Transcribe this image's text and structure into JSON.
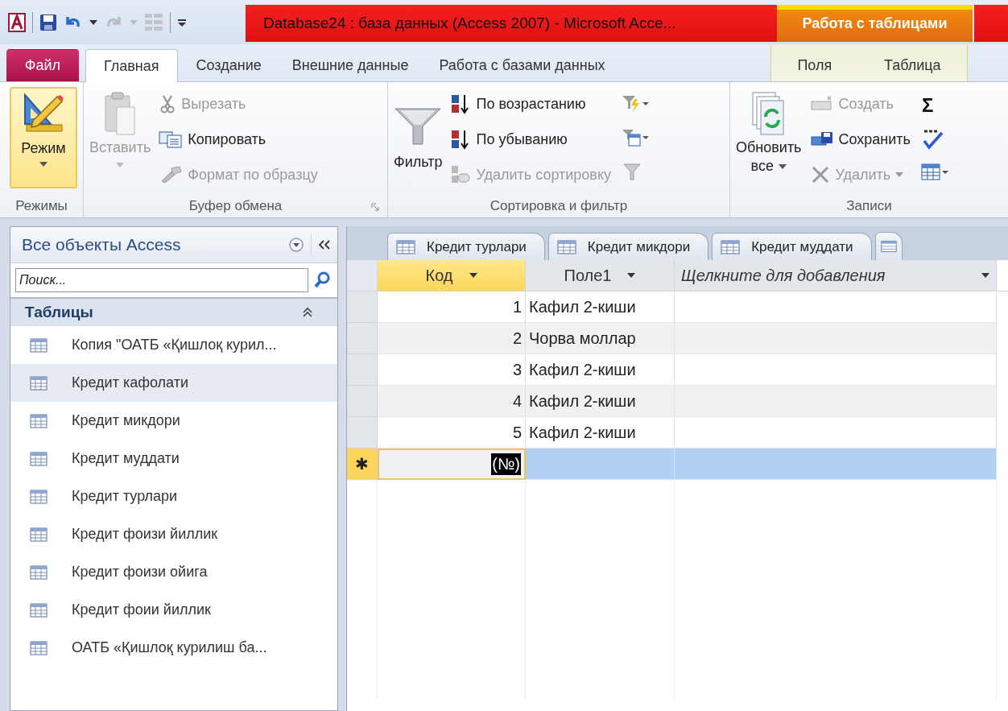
{
  "window": {
    "title": "Database24 : база данных (Access 2007)  -  Microsoft Acce...",
    "context_group": "Работа с таблицами"
  },
  "tabs": [
    {
      "label": "Файл",
      "kind": "file",
      "selected": false
    },
    {
      "label": "Главная",
      "kind": "normal",
      "selected": true
    },
    {
      "label": "Создание",
      "kind": "normal",
      "selected": false
    },
    {
      "label": "Внешние данные",
      "kind": "normal",
      "selected": false
    },
    {
      "label": "Работа с базами данных",
      "kind": "normal",
      "selected": false
    },
    {
      "label": "Поля",
      "kind": "contextual",
      "selected": false
    },
    {
      "label": "Таблица",
      "kind": "contextual",
      "selected": false
    }
  ],
  "ribbon": {
    "groups": [
      {
        "label": "Режимы",
        "items": [
          {
            "label": "Режим",
            "disabled": false
          }
        ]
      },
      {
        "label": "Буфер обмена",
        "items": [
          {
            "label": "Вставить",
            "disabled": true
          },
          {
            "label": "Вырезать",
            "disabled": true
          },
          {
            "label": "Копировать",
            "disabled": false
          },
          {
            "label": "Формат по образцу",
            "disabled": true
          }
        ]
      },
      {
        "label": "Сортировка и фильтр",
        "items": [
          {
            "label": "Фильтр",
            "disabled": false
          },
          {
            "label": "По возрастанию",
            "disabled": false
          },
          {
            "label": "По убыванию",
            "disabled": false
          },
          {
            "label": "Удалить сортировку",
            "disabled": true
          }
        ]
      },
      {
        "label": "Записи",
        "items": [
          {
            "label": "Обновить",
            "label2": "все",
            "disabled": false
          },
          {
            "label": "Создать",
            "disabled": true
          },
          {
            "label": "Сохранить",
            "disabled": false
          },
          {
            "label": "Удалить",
            "disabled": true
          },
          {
            "label": "Σ",
            "disabled": false
          }
        ]
      }
    ]
  },
  "nav": {
    "title": "Все объекты Access",
    "search": {
      "placeholder": "Поиск..."
    },
    "section": "Таблицы",
    "items": [
      {
        "label": "Копия \"ОАТБ «Қишлоқ курил...",
        "selected": false
      },
      {
        "label": "Кредит кафолати",
        "selected": true
      },
      {
        "label": "Кредит микдори",
        "selected": false
      },
      {
        "label": "Кредит муддати",
        "selected": false
      },
      {
        "label": "Кредит турлари",
        "selected": false
      },
      {
        "label": "Кредит фоизи йиллик",
        "selected": false
      },
      {
        "label": "Кредит фоизи ойига",
        "selected": false
      },
      {
        "label": "Кредит фоии йиллик",
        "selected": false
      },
      {
        "label": "ОАТБ «Қишлоқ курилиш  ба...",
        "selected": false
      }
    ]
  },
  "doc_tabs": [
    {
      "label": "Кредит турлари"
    },
    {
      "label": "Кредит микдори"
    },
    {
      "label": "Кредит муддати"
    }
  ],
  "table": {
    "columns": [
      {
        "label": "Код",
        "kind": "field",
        "selected": true
      },
      {
        "label": "Поле1",
        "kind": "field",
        "selected": false
      },
      {
        "label": "Щелкните для добавления",
        "kind": "add",
        "selected": false
      }
    ],
    "rows": [
      {
        "code": "1",
        "field1": "Кафил 2-киши"
      },
      {
        "code": "2",
        "field1": "Чорва моллар"
      },
      {
        "code": "3",
        "field1": "Кафил 2-киши"
      },
      {
        "code": "4",
        "field1": "Кафил 2-киши"
      },
      {
        "code": "5",
        "field1": "Кафил 2-киши"
      }
    ],
    "new_row": {
      "marker": "✱",
      "value": "(№)",
      "selected": true
    }
  }
}
